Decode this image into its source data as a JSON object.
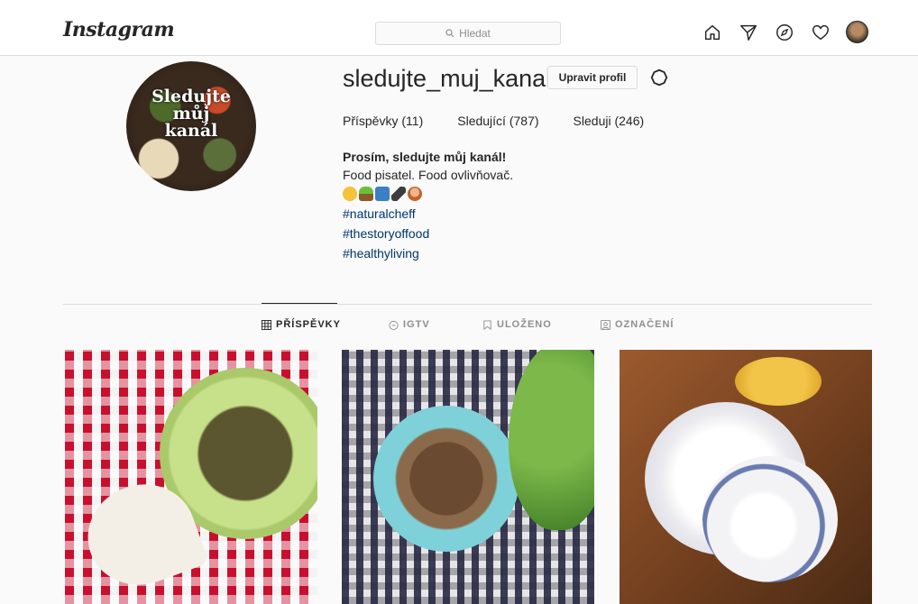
{
  "header": {
    "logo": "Instagram",
    "search_placeholder": "Hledat",
    "icons": [
      "home-icon",
      "direct-icon",
      "explore-icon",
      "activity-icon",
      "profile-avatar"
    ]
  },
  "profile": {
    "username": "sledujte_muj_kanal",
    "edit_label": "Upravit profil",
    "picture_text": [
      "Sledujte",
      "můj",
      "kanál"
    ],
    "stats": {
      "posts_label": "Příspěvky",
      "posts_count": "11",
      "followers_label": "Sledující",
      "followers_count": "787",
      "following_label": "Sleduji",
      "following_count": "246"
    },
    "bio": {
      "name": "Prosím, sledujte můj kanál!",
      "line": "Food pisatel. Food ovlivňovač.",
      "emojis": [
        "smiling-face",
        "seedling",
        "vegan-badge",
        "chili-pepper",
        "person"
      ],
      "hashtags": [
        "#naturalcheff",
        "#thestoryoffood",
        "#healthyliving"
      ]
    }
  },
  "tabs": [
    {
      "label": "PŘÍSPĚVKY",
      "icon": "grid-icon",
      "active": true
    },
    {
      "label": "IGTV",
      "icon": "igtv-icon",
      "active": false
    },
    {
      "label": "ULOŽENO",
      "icon": "bookmark-icon",
      "active": false
    },
    {
      "label": "OZNAČENÍ",
      "icon": "tagged-icon",
      "active": false
    }
  ],
  "colors": {
    "link": "#003569",
    "border": "#dbdbdb",
    "muted": "#8e8e8e",
    "text": "#262626"
  }
}
